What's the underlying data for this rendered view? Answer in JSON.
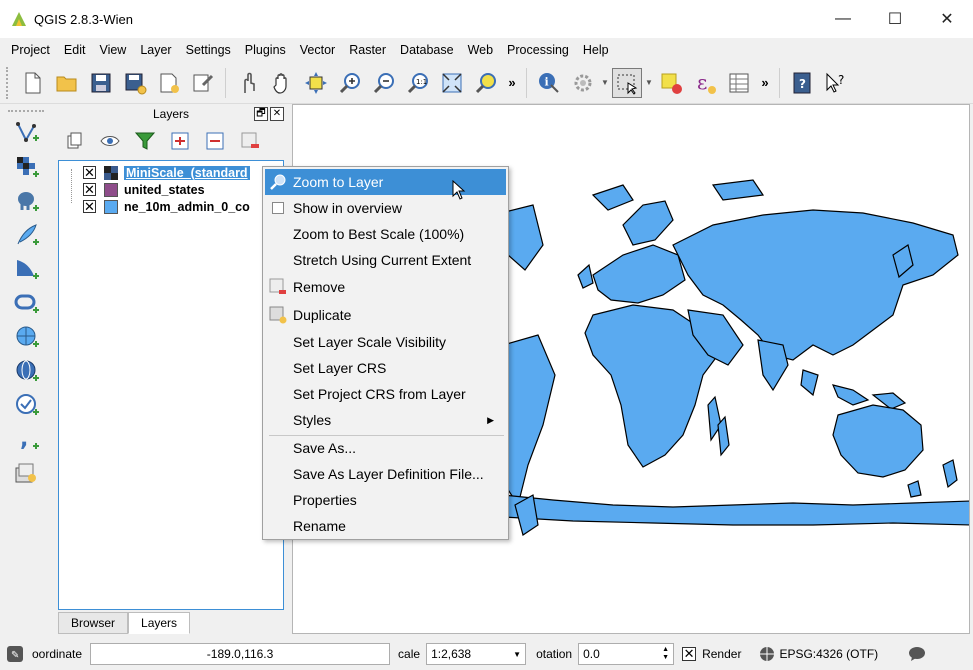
{
  "window": {
    "title": "QGIS 2.8.3-Wien",
    "minimize": "—",
    "maximize": "☐",
    "close": "✕"
  },
  "menu": [
    "Project",
    "Edit",
    "View",
    "Layer",
    "Settings",
    "Plugins",
    "Vector",
    "Raster",
    "Database",
    "Web",
    "Processing",
    "Help"
  ],
  "toolbar": {
    "more_label": "»"
  },
  "layers_panel": {
    "title": "Layers",
    "float_btn": "🗗",
    "close_btn": "✕",
    "layers": [
      {
        "name": "MiniScale_(standard",
        "checked": "✕",
        "swatch_color": "#3a5a8c"
      },
      {
        "name": "united_states",
        "checked": "✕",
        "swatch_color": "#8e4d8a"
      },
      {
        "name": "ne_10m_admin_0_co",
        "checked": "✕",
        "swatch_color": "#5aaaf0"
      }
    ],
    "tabs": [
      "Browser",
      "Layers"
    ]
  },
  "context_menu": {
    "items": [
      "Zoom to Layer",
      "Show in overview",
      "Zoom to Best Scale (100%)",
      "Stretch Using Current Extent",
      "Remove",
      "Duplicate",
      "Set Layer Scale Visibility",
      "Set Layer CRS",
      "Set Project CRS from Layer",
      "Styles",
      "Save As...",
      "Save As Layer Definition File...",
      "Properties",
      "Rename"
    ]
  },
  "statusbar": {
    "coordinate_label": "oordinate",
    "coordinate_value": "-189.0,116.3",
    "scale_label": "cale",
    "scale_value": "1:2,638",
    "rotation_label": "otation",
    "rotation_value": "0.0",
    "render_check": "✕",
    "render_label": "Render",
    "crs_label": "EPSG:4326 (OTF)"
  },
  "colors": {
    "accent": "#3d8fd6",
    "map_fill": "#5aaaf0",
    "map_stroke": "#000000"
  }
}
